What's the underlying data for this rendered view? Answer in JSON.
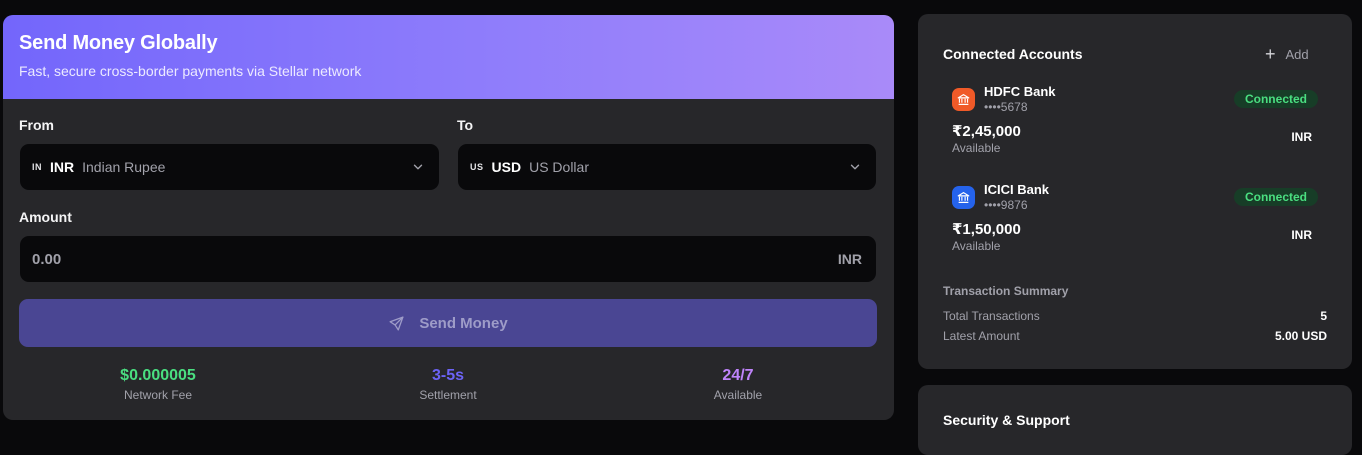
{
  "send": {
    "title": "Send Money Globally",
    "subtitle": "Fast, secure cross-border payments via Stellar network",
    "from_label": "From",
    "to_label": "To",
    "from": {
      "flag": "IN",
      "code": "INR",
      "name": "Indian Rupee"
    },
    "to": {
      "flag": "US",
      "code": "USD",
      "name": "US Dollar"
    },
    "amount_label": "Amount",
    "amount_placeholder": "0.00",
    "amount_currency": "INR",
    "button_label": "Send Money",
    "stats": [
      {
        "value": "$0.000005",
        "label": "Network Fee",
        "color": "#4ade80"
      },
      {
        "value": "3-5s",
        "label": "Settlement",
        "color": "#6c63f5"
      },
      {
        "value": "24/7",
        "label": "Available",
        "color": "#c084fc"
      }
    ]
  },
  "accounts": {
    "title": "Connected Accounts",
    "add_label": "Add",
    "items": [
      {
        "bank": "HDFC Bank",
        "number": "••••5678",
        "status": "Connected",
        "balance": "₹2,45,000",
        "balance_label": "Available",
        "currency": "INR",
        "icon_color": "#f05a28"
      },
      {
        "bank": "ICICI Bank",
        "number": "••••9876",
        "status": "Connected",
        "balance": "₹1,50,000",
        "balance_label": "Available",
        "currency": "INR",
        "icon_color": "#2563eb"
      }
    ],
    "summary": {
      "title": "Transaction Summary",
      "total_label": "Total Transactions",
      "total_value": "5",
      "latest_label": "Latest Amount",
      "latest_value": "5.00 USD"
    }
  },
  "security": {
    "title": "Security & Support"
  }
}
